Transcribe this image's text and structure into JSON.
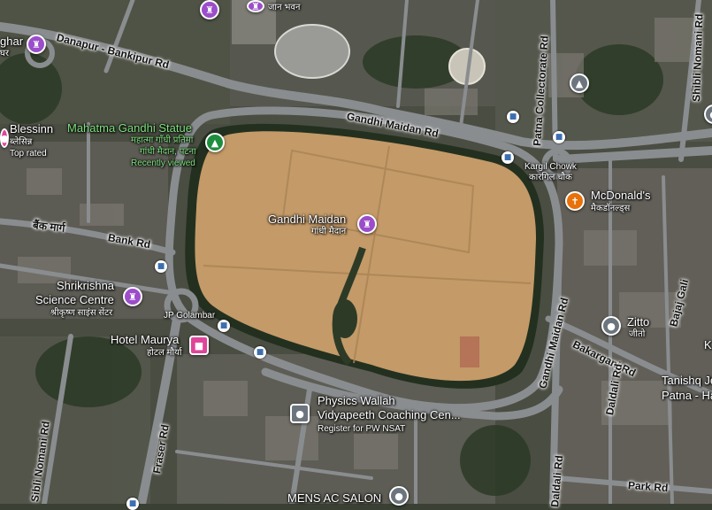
{
  "colors": {
    "road": "#8a8d8f",
    "ground": "#c39a68",
    "vegetation": "#2f3a28",
    "urban": "#6b6a63",
    "pin_purple": "#9b4dca",
    "pin_green": "#1e8e3e",
    "pin_orange": "#e8710a",
    "pin_pink": "#e0459a",
    "pin_gray": "#6c757d",
    "pin_blue": "#3d6fb0",
    "label_green": "#7fe07f"
  },
  "places": {
    "gandhi_maidan": {
      "name": "Gandhi Maidan",
      "local": "गांधी मैदान",
      "icon": "landmark-icon"
    },
    "mahatma_statue": {
      "name": "Mahatma Gandhi Statue",
      "local": "महात्मा गाँधी प्रतिमा",
      "local2": "गांधी मैदान, पटना",
      "status": "Recently viewed",
      "icon": "tree-icon"
    },
    "blessinn": {
      "name": "Blessinn",
      "local": "ब्लेसिन्न",
      "rating": "Top rated"
    },
    "ghar": {
      "name": "ghar",
      "local": "घर",
      "icon": "landmark-icon"
    },
    "top_local": {
      "local": "जान भवन",
      "icon": "landmark-icon"
    },
    "science_centre": {
      "name": "Shrikrishna",
      "name2": "Science Centre",
      "local": "श्रीकृष्ण साइंस सेंटर",
      "icon": "landmark-icon"
    },
    "hotel_maurya": {
      "name": "Hotel Maurya",
      "local": "होटल मौर्या",
      "icon": "hotel-icon"
    },
    "physics_wallah": {
      "name": "Physics Wallah",
      "name2": "Vidyapeeth Coaching Cen...",
      "note": "Register for PW NSAT",
      "icon": "school-icon"
    },
    "mcdonalds": {
      "name": "McDonald's",
      "local": "मैकडॉनल्ड्स",
      "icon": "restaurant-icon"
    },
    "zitto": {
      "name": "Zitto",
      "local": "जीतो",
      "icon": "location-pin-icon"
    },
    "kargil_chowk": {
      "name": "Kargil Chowk",
      "local": "कारगिल चौक"
    },
    "tanishq": {
      "name": "Tanishq Jew",
      "name2": "Patna - Hatwa"
    },
    "mens_salon": {
      "name": "MENS AC SALON",
      "icon": "location-pin-icon"
    },
    "jp_golambar": {
      "name": "JP Golambar"
    },
    "bank_local": {
      "local": "बैंक मार्ग"
    }
  },
  "roads": {
    "danapur": "Danapur - Bankipur Rd",
    "gandhi_maidan_rd_n": "Gandhi Maidan Rd",
    "gandhi_maidan_rd_e": "Gandhi Maidan Rd",
    "bank_rd": "Bank Rd",
    "fraser_rd": "Fraser Rd",
    "patna_collectorate": "Patna Collectorate Rd",
    "bakarganj": "Bakarganj Rd",
    "dalda_rd": "Daldali Rd",
    "dalda_rd_2": "Daldali Rd",
    "bajaj_gali": "Bajaj Gali",
    "kargil_rd": "Kargil Rd",
    "park_rd": "Park Rd",
    "boring_rd": "Sibli Nomani Rd",
    "shibli_nomani": "Shibli Nomani Rd"
  },
  "edge": {
    "k": "K"
  }
}
